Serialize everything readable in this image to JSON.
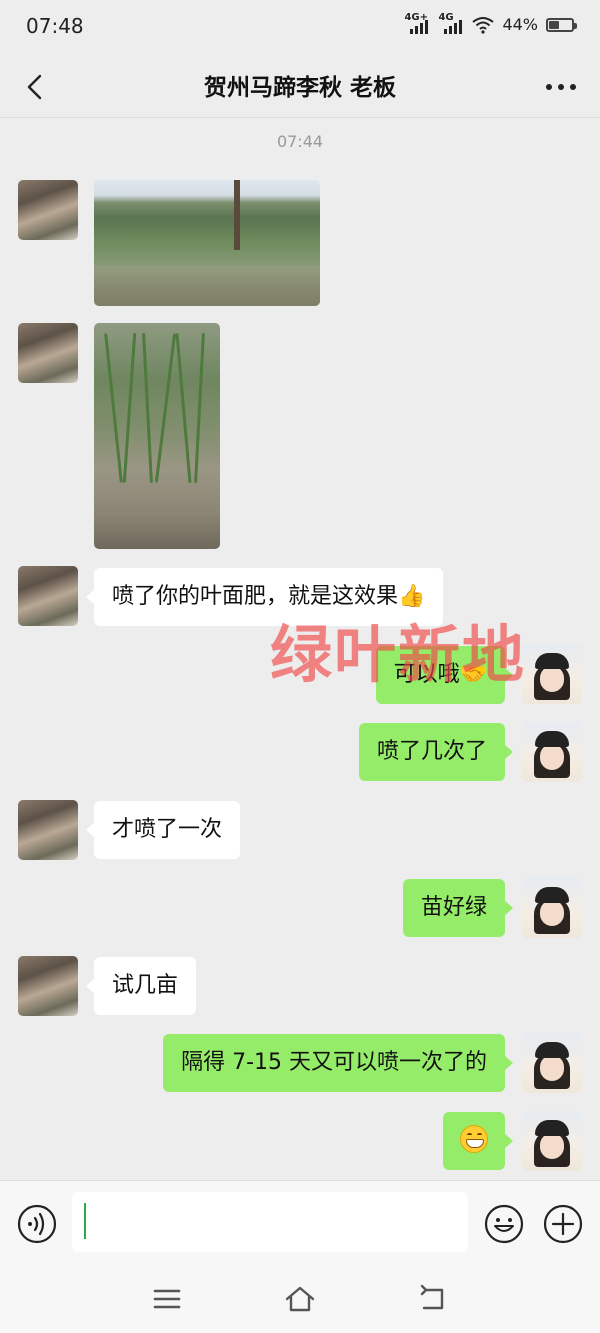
{
  "status_bar": {
    "time": "07:48",
    "network_1": "4G+",
    "network_2": "4G",
    "battery_percent": "44%",
    "battery_level": 0.44
  },
  "nav": {
    "title": "贺州马蹄李秋  老板",
    "back_icon": "chevron-left-icon",
    "more_icon": "more-dots-icon"
  },
  "chat": {
    "timestamp": "07:44",
    "messages": [
      {
        "side": "in",
        "type": "image",
        "alt": "paddy-field-photo"
      },
      {
        "side": "in",
        "type": "image",
        "alt": "rice-seedlings-photo"
      },
      {
        "side": "in",
        "type": "text",
        "text": "喷了你的叶面肥，就是这效果",
        "emoji": "👍"
      },
      {
        "side": "out",
        "type": "text",
        "text": "可以哦",
        "emoji": "🤝"
      },
      {
        "side": "out",
        "type": "text",
        "text": "喷了几次了"
      },
      {
        "side": "in",
        "type": "text",
        "text": "才喷了一次"
      },
      {
        "side": "out",
        "type": "text",
        "text": "苗好绿"
      },
      {
        "side": "in",
        "type": "text",
        "text": "试几亩"
      },
      {
        "side": "out",
        "type": "text",
        "text": "隔得 7-15 天又可以喷一次了的"
      },
      {
        "side": "out",
        "type": "sticker",
        "emoji": "grin-emoji"
      }
    ]
  },
  "watermark": "绿叶新地",
  "input_bar": {
    "value": "",
    "voice_icon": "voice-icon",
    "emoji_icon": "smiley-icon",
    "plus_icon": "plus-icon"
  },
  "system_nav": {
    "menu_icon": "menu-icon",
    "home_icon": "home-icon",
    "back_icon": "back-icon"
  }
}
